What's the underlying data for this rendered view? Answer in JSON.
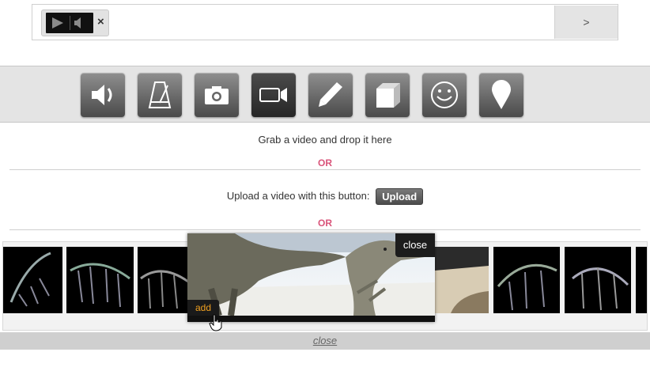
{
  "composer": {
    "attachment_remove_label": "×",
    "send_label": ">"
  },
  "toolbar": {
    "tools": [
      {
        "name": "sound",
        "icon": "speaker-icon"
      },
      {
        "name": "metronome",
        "icon": "metronome-icon"
      },
      {
        "name": "photo",
        "icon": "camera-icon"
      },
      {
        "name": "video",
        "icon": "video-camera-icon",
        "active": true
      },
      {
        "name": "draw",
        "icon": "pencil-icon"
      },
      {
        "name": "3d",
        "icon": "cube-icon"
      },
      {
        "name": "emoji",
        "icon": "smiley-icon"
      },
      {
        "name": "location",
        "icon": "map-pin-icon"
      }
    ]
  },
  "main": {
    "drop_text": "Grab a video and drop it here",
    "or_1": "OR",
    "upload_text": "Upload a video with this button:",
    "upload_button": "Upload",
    "or_2": "OR"
  },
  "preview": {
    "close_label": "close",
    "add_label": "add"
  },
  "footer": {
    "close_label": "close"
  },
  "colors": {
    "or_accent": "#d9547a",
    "add_accent": "#f0a020",
    "toolbar_bg": "#e4e4e4"
  }
}
